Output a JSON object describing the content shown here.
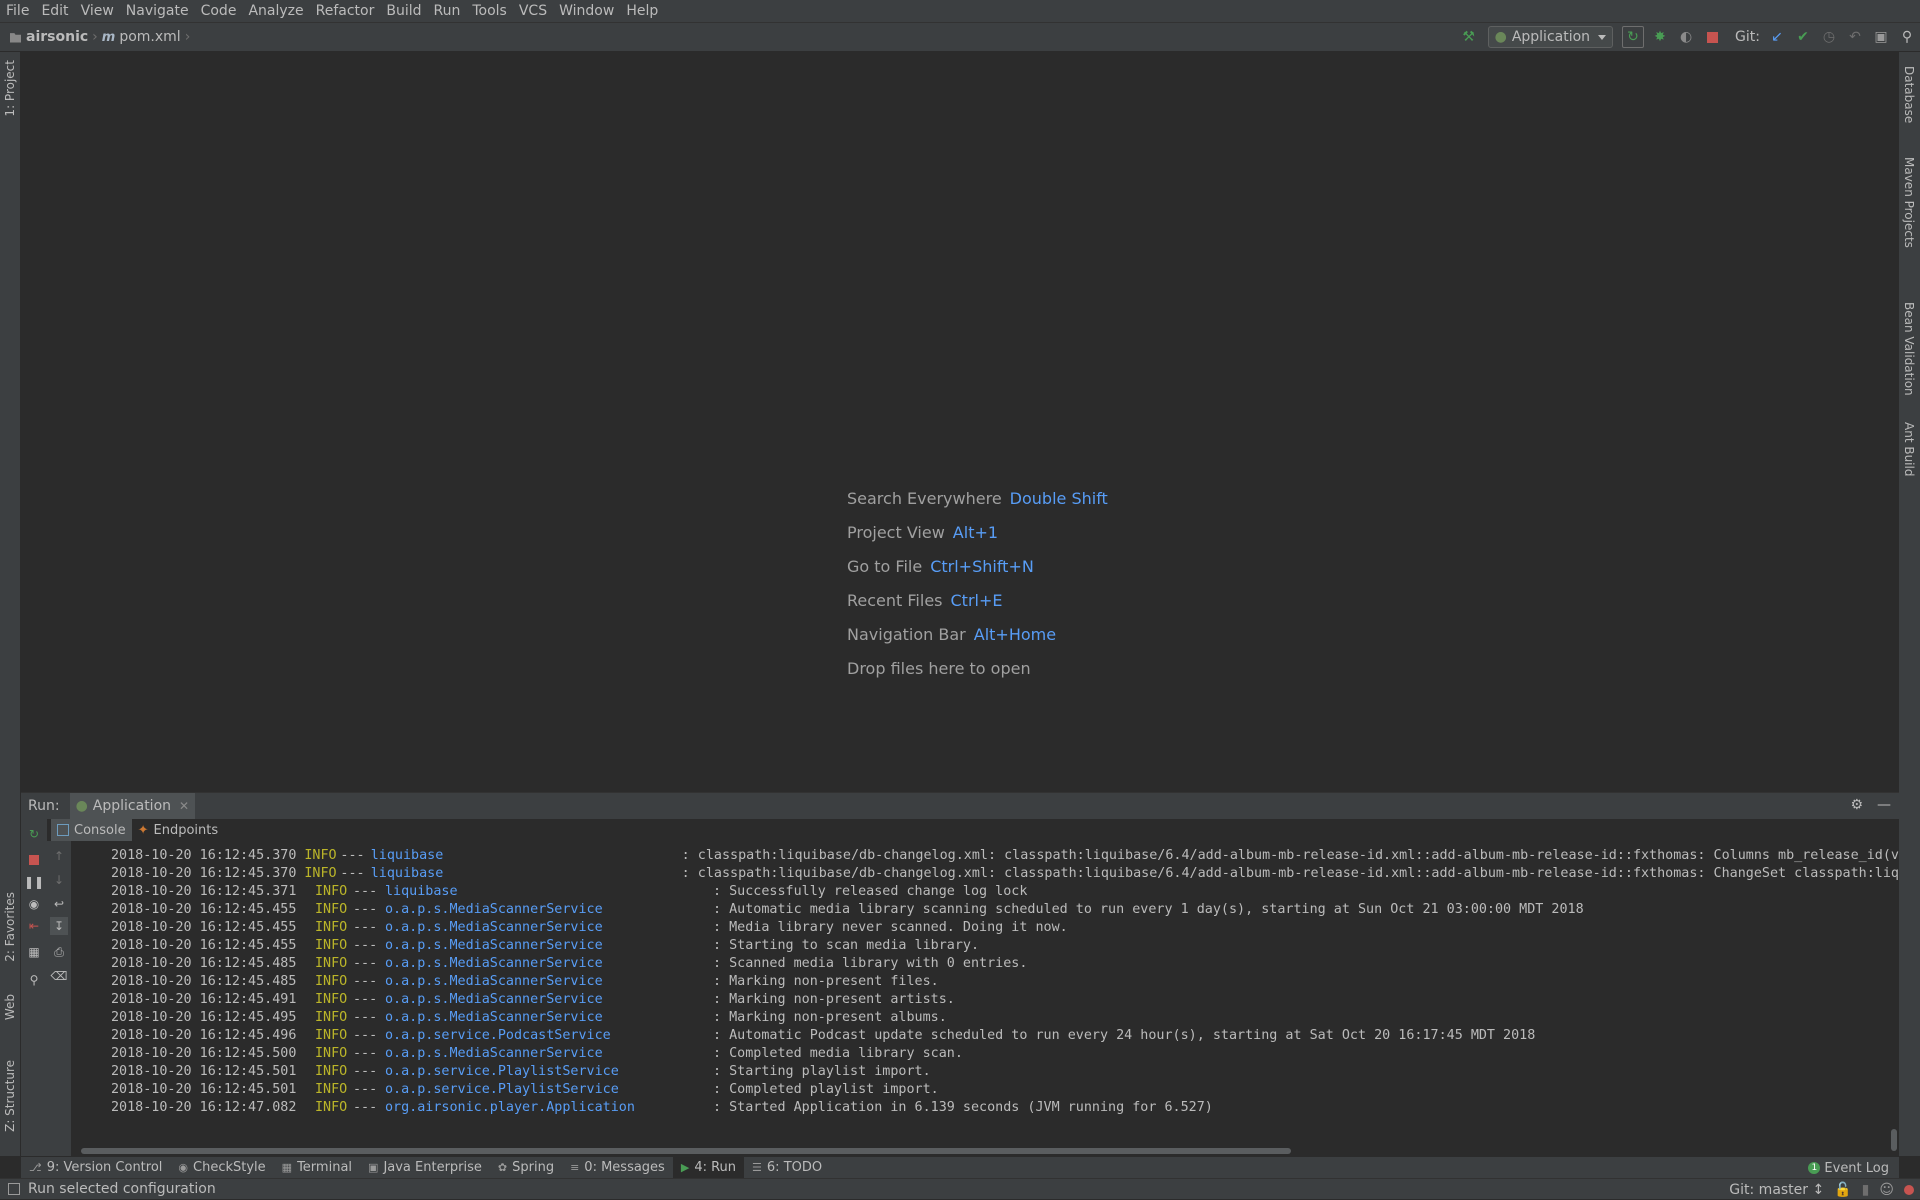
{
  "menu": [
    "File",
    "Edit",
    "View",
    "Navigate",
    "Code",
    "Analyze",
    "Refactor",
    "Build",
    "Run",
    "Tools",
    "VCS",
    "Window",
    "Help"
  ],
  "breadcrumb": {
    "project": "airsonic",
    "file": "pom.xml"
  },
  "toolbar": {
    "run_config": "Application",
    "git_label": "Git:"
  },
  "left_tool_tabs": {
    "project": "1: Project",
    "favorites": "2: Favorites",
    "web": "Web",
    "structure": "Z: Structure"
  },
  "right_tool_tabs": {
    "database": "Database",
    "maven": "Maven Projects",
    "bean": "Bean Validation",
    "ant": "Ant Build"
  },
  "hints": [
    {
      "label": "Search Everywhere",
      "key": "Double Shift"
    },
    {
      "label": "Project View",
      "key": "Alt+1"
    },
    {
      "label": "Go to File",
      "key": "Ctrl+Shift+N"
    },
    {
      "label": "Recent Files",
      "key": "Ctrl+E"
    },
    {
      "label": "Navigation Bar",
      "key": "Alt+Home"
    },
    {
      "label": "Drop files here to open",
      "key": ""
    }
  ],
  "run_panel": {
    "label": "Run:",
    "tab": "Application",
    "subtabs": {
      "console": "Console",
      "endpoints": "Endpoints"
    }
  },
  "console_lines": [
    {
      "date": "2018-10-20 16:12:45.370",
      "level": "INFO",
      "dash": "---",
      "logger": "liquibase",
      "msg": ": classpath:liquibase/db-changelog.xml: classpath:liquibase/6.4/add-album-mb-release-id.xml::add-album-mb-release-id::fxthomas: Columns mb_release_id(v"
    },
    {
      "date": "2018-10-20 16:12:45.370",
      "level": "INFO",
      "dash": "---",
      "logger": "liquibase",
      "msg": ": classpath:liquibase/db-changelog.xml: classpath:liquibase/6.4/add-album-mb-release-id.xml::add-album-mb-release-id::fxthomas: ChangeSet classpath:liq"
    },
    {
      "date": "2018-10-20 16:12:45.371",
      "level": "INFO",
      "dash": "---",
      "logger": "liquibase",
      "msg": ": Successfully released change log lock"
    },
    {
      "date": "2018-10-20 16:12:45.455",
      "level": "INFO",
      "dash": "---",
      "logger": "o.a.p.s.MediaScannerService",
      "msg": ": Automatic media library scanning scheduled to run every 1 day(s), starting at Sun Oct 21 03:00:00 MDT 2018"
    },
    {
      "date": "2018-10-20 16:12:45.455",
      "level": "INFO",
      "dash": "---",
      "logger": "o.a.p.s.MediaScannerService",
      "msg": ": Media library never scanned. Doing it now."
    },
    {
      "date": "2018-10-20 16:12:45.455",
      "level": "INFO",
      "dash": "---",
      "logger": "o.a.p.s.MediaScannerService",
      "msg": ": Starting to scan media library."
    },
    {
      "date": "2018-10-20 16:12:45.485",
      "level": "INFO",
      "dash": "---",
      "logger": "o.a.p.s.MediaScannerService",
      "msg": ": Scanned media library with 0 entries."
    },
    {
      "date": "2018-10-20 16:12:45.485",
      "level": "INFO",
      "dash": "---",
      "logger": "o.a.p.s.MediaScannerService",
      "msg": ": Marking non-present files."
    },
    {
      "date": "2018-10-20 16:12:45.491",
      "level": "INFO",
      "dash": "---",
      "logger": "o.a.p.s.MediaScannerService",
      "msg": ": Marking non-present artists."
    },
    {
      "date": "2018-10-20 16:12:45.495",
      "level": "INFO",
      "dash": "---",
      "logger": "o.a.p.s.MediaScannerService",
      "msg": ": Marking non-present albums."
    },
    {
      "date": "2018-10-20 16:12:45.496",
      "level": "INFO",
      "dash": "---",
      "logger": "o.a.p.service.PodcastService",
      "msg": ": Automatic Podcast update scheduled to run every 24 hour(s), starting at Sat Oct 20 16:17:45 MDT 2018"
    },
    {
      "date": "2018-10-20 16:12:45.500",
      "level": "INFO",
      "dash": "---",
      "logger": "o.a.p.s.MediaScannerService",
      "msg": ": Completed media library scan."
    },
    {
      "date": "2018-10-20 16:12:45.501",
      "level": "INFO",
      "dash": "---",
      "logger": "o.a.p.service.PlaylistService",
      "msg": ": Starting playlist import."
    },
    {
      "date": "2018-10-20 16:12:45.501",
      "level": "INFO",
      "dash": "---",
      "logger": "o.a.p.service.PlaylistService",
      "msg": ": Completed playlist import."
    },
    {
      "date": "2018-10-20 16:12:47.082",
      "level": "INFO",
      "dash": "---",
      "logger": "org.airsonic.player.Application",
      "msg": ": Started Application in 6.139 seconds (JVM running for 6.527)"
    }
  ],
  "bottom_tabs": [
    {
      "label": "9: Version Control",
      "icon": "vcs-icon"
    },
    {
      "label": "CheckStyle",
      "icon": "checkstyle-icon"
    },
    {
      "label": "Terminal",
      "icon": "terminal-icon"
    },
    {
      "label": "Java Enterprise",
      "icon": "java-ee-icon"
    },
    {
      "label": "Spring",
      "icon": "spring-icon"
    },
    {
      "label": "0: Messages",
      "icon": "messages-icon"
    },
    {
      "label": "4: Run",
      "icon": "run-icon"
    },
    {
      "label": "6: TODO",
      "icon": "todo-icon"
    }
  ],
  "event_log": {
    "label": "Event Log",
    "count": "1"
  },
  "status": {
    "text": "Run selected configuration",
    "git_branch": "Git: master ↕"
  },
  "colors": {
    "accent_blue": "#589df6",
    "info_yellow": "#bbb529",
    "run_green": "#499c54",
    "stop_red": "#c75450"
  }
}
